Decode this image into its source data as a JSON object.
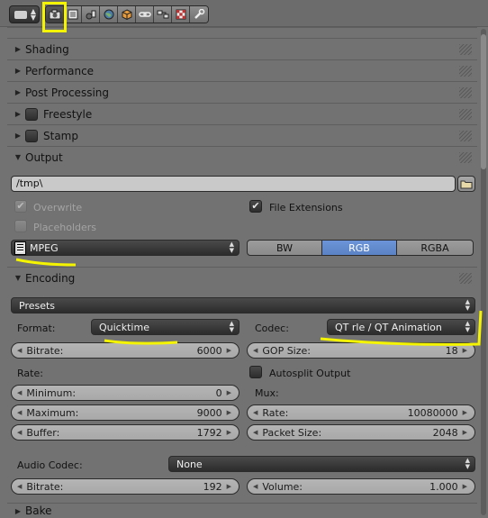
{
  "panels": {
    "shading": "Shading",
    "performance": "Performance",
    "post_processing": "Post Processing",
    "freestyle": "Freestyle",
    "stamp": "Stamp",
    "output": "Output",
    "encoding": "Encoding",
    "bake": "Bake"
  },
  "output": {
    "path": "/tmp\\",
    "overwrite": "Overwrite",
    "file_extensions": "File Extensions",
    "placeholders": "Placeholders",
    "file_format": "MPEG",
    "color_modes": [
      "BW",
      "RGB",
      "RGBA"
    ],
    "color_mode_selected": "RGB"
  },
  "encoding": {
    "presets": "Presets",
    "format_label": "Format:",
    "format_value": "Quicktime",
    "codec_label": "Codec:",
    "codec_value": "QT rle / QT Animation",
    "bitrate_label": "Bitrate:",
    "bitrate_value": "6000",
    "gop_label": "GOP Size:",
    "gop_value": "18",
    "rate_heading": "Rate:",
    "autosplit": "Autosplit Output",
    "minimum_label": "Minimum:",
    "minimum_value": "0",
    "mux_heading": "Mux:",
    "maximum_label": "Maximum:",
    "maximum_value": "9000",
    "mux_rate_label": "Rate:",
    "mux_rate_value": "10080000",
    "buffer_label": "Buffer:",
    "buffer_value": "1792",
    "packet_label": "Packet Size:",
    "packet_value": "2048",
    "audio_codec_label": "Audio Codec:",
    "audio_codec_value": "None",
    "audio_bitrate_label": "Bitrate:",
    "audio_bitrate_value": "192",
    "volume_label": "Volume:",
    "volume_value": "1.000"
  },
  "colors": {
    "highlight": "#f4f400",
    "accent_blue": "#5a82c4"
  }
}
